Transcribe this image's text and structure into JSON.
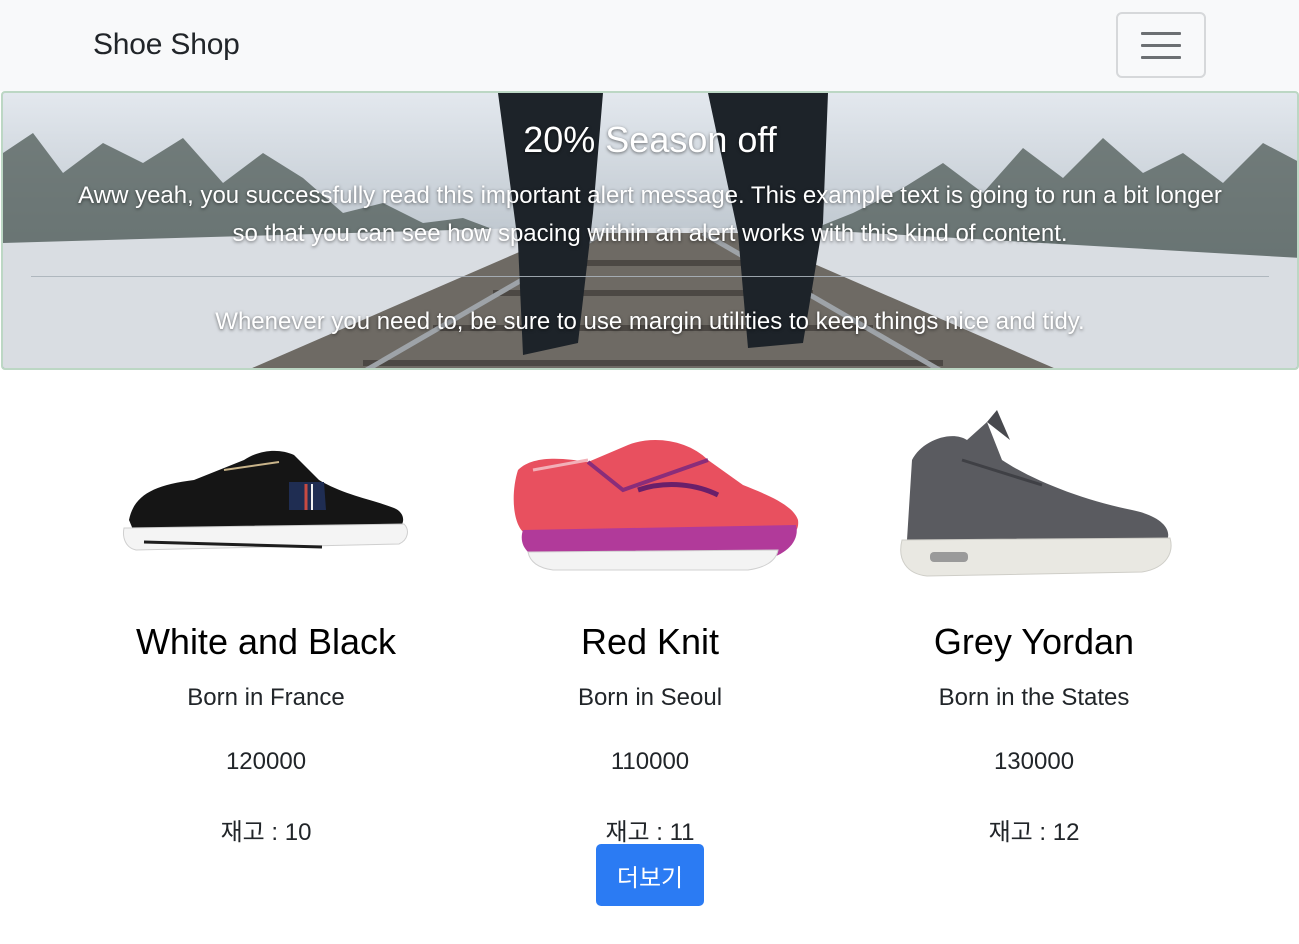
{
  "navbar": {
    "brand": "Shoe Shop",
    "toggler_icon": "hamburger-menu-icon"
  },
  "banner": {
    "title": "20% Season off",
    "text": "Aww yeah, you successfully read this important alert message. This example text is going to run a bit longer so that you can see how spacing within an alert works with this kind of content.",
    "note": "Whenever you need to, be sure to use margin utilities to keep things nice and tidy."
  },
  "products": [
    {
      "name": "White and Black",
      "origin": "Born in France",
      "price": "120000",
      "stock": "재고 : 10",
      "image": "black-sneaker-image"
    },
    {
      "name": "Red Knit",
      "origin": "Born in Seoul",
      "price": "110000",
      "stock": "재고 : 11",
      "image": "red-running-shoe-image"
    },
    {
      "name": "Grey Yordan",
      "origin": "Born in the States",
      "price": "130000",
      "stock": "재고 : 12",
      "image": "grey-hightop-sneaker-image"
    }
  ],
  "more_button": {
    "label": "더보기"
  },
  "colors": {
    "navbar_bg": "#f8f9fa",
    "primary": "#2b7bf3",
    "banner_border": "#bcd7c4"
  }
}
